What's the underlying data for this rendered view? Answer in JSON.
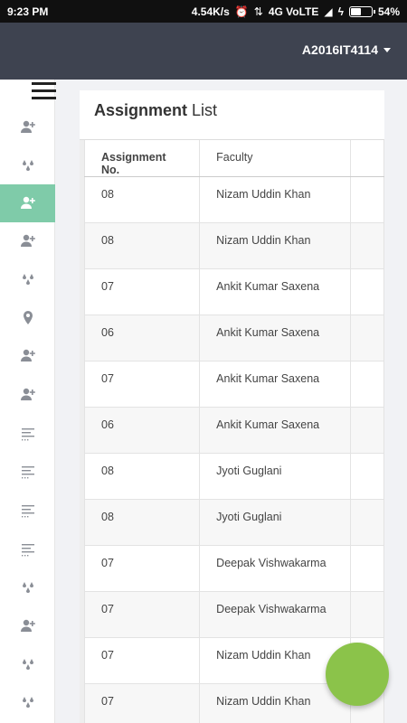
{
  "status_bar": {
    "time": "9:23 PM",
    "net_speed": "4.54K/s",
    "network": "4G VoLTE",
    "battery": "54%",
    "battery_level": 0.54
  },
  "header": {
    "user_id": "A2016IT4114"
  },
  "sidebar": {
    "items": [
      {
        "icon": "add-user-icon"
      },
      {
        "icon": "drops-icon"
      },
      {
        "icon": "add-user-icon",
        "active": true
      },
      {
        "icon": "add-user-icon"
      },
      {
        "icon": "drops-icon"
      },
      {
        "icon": "location-pin-icon"
      },
      {
        "icon": "add-user-icon"
      },
      {
        "icon": "add-user-icon"
      },
      {
        "icon": "list-icon"
      },
      {
        "icon": "list-icon"
      },
      {
        "icon": "list-icon"
      },
      {
        "icon": "list-icon"
      },
      {
        "icon": "drops-icon"
      },
      {
        "icon": "add-user-icon"
      },
      {
        "icon": "drops-icon"
      },
      {
        "icon": "drops-icon"
      }
    ]
  },
  "card": {
    "title_bold": "Assignment",
    "title_rest": " List",
    "columns": [
      "Assignment No.",
      "Faculty"
    ],
    "rows": [
      {
        "no": "08",
        "faculty": "Nizam Uddin Khan"
      },
      {
        "no": "08",
        "faculty": "Nizam Uddin Khan"
      },
      {
        "no": "07",
        "faculty": "Ankit Kumar Saxena"
      },
      {
        "no": "06",
        "faculty": "Ankit Kumar Saxena"
      },
      {
        "no": "07",
        "faculty": "Ankit Kumar Saxena"
      },
      {
        "no": "06",
        "faculty": "Ankit Kumar Saxena"
      },
      {
        "no": "08",
        "faculty": "Jyoti Guglani"
      },
      {
        "no": "08",
        "faculty": "Jyoti Guglani"
      },
      {
        "no": "07",
        "faculty": "Deepak Vishwakarma"
      },
      {
        "no": "07",
        "faculty": "Deepak Vishwakarma"
      },
      {
        "no": "07",
        "faculty": "Nizam Uddin Khan"
      },
      {
        "no": "07",
        "faculty": "Nizam Uddin Khan"
      }
    ]
  },
  "colors": {
    "topbar": "#3e4350",
    "active_sidebar": "#7fcba9",
    "fab": "#8bc34a"
  }
}
